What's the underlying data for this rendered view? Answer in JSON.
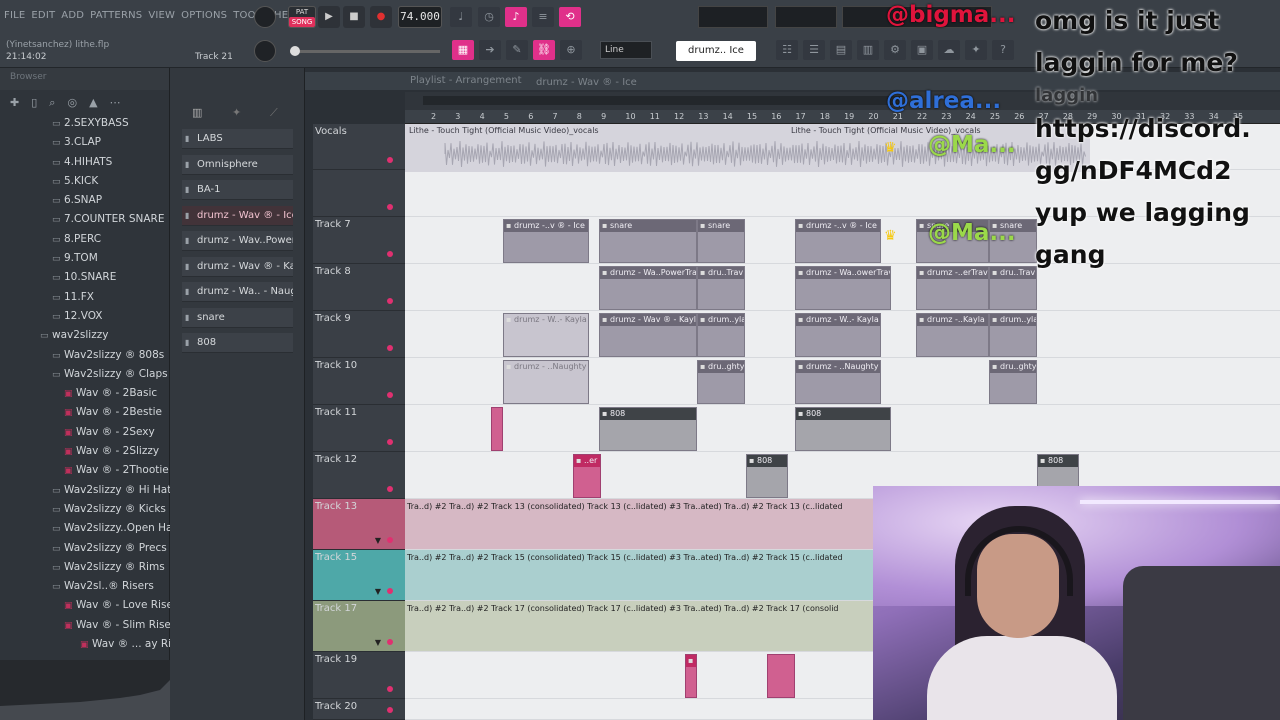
{
  "menu": [
    "FILE",
    "EDIT",
    "ADD",
    "PATTERNS",
    "VIEW",
    "OPTIONS",
    "TOOLS",
    "HELP"
  ],
  "topbar": {
    "hint": "(Yinetsanchez) lithe.flp",
    "clock": "21:14:02",
    "track_indicator": "Track 21",
    "pat_label": "PAT",
    "song_label": "SONG",
    "tempo": "74.000",
    "snap": "Line",
    "pattern": "drumz.. Ice"
  },
  "browser": {
    "title": "Browser",
    "items": [
      {
        "icon": "folder",
        "label": "2.SEXYBASS",
        "indent": 52
      },
      {
        "icon": "folder",
        "label": "3.CLAP",
        "indent": 52
      },
      {
        "icon": "folder",
        "label": "4.HIHATS",
        "indent": 52
      },
      {
        "icon": "folder",
        "label": "5.KICK",
        "indent": 52
      },
      {
        "icon": "folder",
        "label": "6.SNAP",
        "indent": 52
      },
      {
        "icon": "folder",
        "label": "7.COUNTER SNARE",
        "indent": 52
      },
      {
        "icon": "folder",
        "label": "8.PERC",
        "indent": 52
      },
      {
        "icon": "folder",
        "label": "9.TOM",
        "indent": 52
      },
      {
        "icon": "folder",
        "label": "10.SNARE",
        "indent": 52
      },
      {
        "icon": "folder",
        "label": "11.FX",
        "indent": 52
      },
      {
        "icon": "folder",
        "label": "12.VOX",
        "indent": 52
      },
      {
        "icon": "folder",
        "label": "wav2slizzy",
        "indent": 40
      },
      {
        "icon": "folder",
        "label": "Wav2slizzy ® 808s",
        "indent": 52
      },
      {
        "icon": "folder",
        "label": "Wav2slizzy ® Claps",
        "indent": 52
      },
      {
        "icon": "pattern",
        "label": "Wav ® - 2Basic",
        "indent": 64
      },
      {
        "icon": "pattern",
        "label": "Wav ® - 2Bestie",
        "indent": 64
      },
      {
        "icon": "pattern",
        "label": "Wav ® - 2Sexy",
        "indent": 64
      },
      {
        "icon": "pattern",
        "label": "Wav ® - 2Slizzy",
        "indent": 64
      },
      {
        "icon": "pattern",
        "label": "Wav ® - 2Thootie",
        "indent": 64
      },
      {
        "icon": "folder",
        "label": "Wav2slizzy ® Hi Hats",
        "indent": 52
      },
      {
        "icon": "folder",
        "label": "Wav2slizzy ® Kicks",
        "indent": 52
      },
      {
        "icon": "folder",
        "label": "Wav2slizzy..Open Hats",
        "indent": 52
      },
      {
        "icon": "folder",
        "label": "Wav2slizzy ® Precs",
        "indent": 52
      },
      {
        "icon": "folder",
        "label": "Wav2slizzy ® Rims",
        "indent": 52
      },
      {
        "icon": "folder",
        "label": "Wav2sl..® Risers",
        "indent": 52
      },
      {
        "icon": "pattern",
        "label": "Wav ® - Love Riser",
        "indent": 64
      },
      {
        "icon": "pattern",
        "label": "Wav ® - Slim Riser",
        "indent": 64
      },
      {
        "icon": "pattern",
        "label": "Wav ® ... ay Riser",
        "indent": 80
      }
    ]
  },
  "channels": [
    "LABS",
    "Omnisphere",
    "BA-1",
    "drumz - Wav ® - Ice",
    "drumz - Wav..PowerTrav",
    "drumz - Wav ® - Kayla",
    "drumz - Wa.. - Naughty",
    "snare",
    "808"
  ],
  "playlist": {
    "title": "Playlist - Arrangement",
    "pattern": "drumz - Wav ® - Ice",
    "ruler": [
      "2",
      "3",
      "4",
      "5",
      "6",
      "7",
      "8",
      "9",
      "10",
      "11",
      "12",
      "13",
      "14",
      "15",
      "16",
      "17",
      "18",
      "19",
      "20",
      "21",
      "22",
      "23",
      "24",
      "25",
      "26",
      "27",
      "28",
      "29",
      "30",
      "31",
      "32",
      "33",
      "34",
      "35"
    ],
    "tracks": [
      "Vocals",
      "",
      "Track 7",
      "Track 8",
      "Track 9",
      "Track 10",
      "Track 11",
      "Track 12",
      "Track 13",
      "Track 15",
      "Track 17",
      "Track 19",
      "Track 20"
    ],
    "vocal_clips": [
      "Lithe - Touch Tight (Official Music Video)_vocals",
      "Lithe - Touch Tight (Official Music Video)_vocals"
    ],
    "clips": {
      "t7": [
        "drumz -..v ® - Ice",
        "snare",
        "snare",
        "drumz -..v ® - Ice",
        "snare",
        "snare"
      ],
      "t8": [
        "drumz - Wa..PowerTrav",
        "dru..Trav",
        "drumz - Wa..owerTrav",
        "drumz -..erTrav",
        "dru..Trav"
      ],
      "t9": [
        "drumz - W..- Kayla",
        "drumz - Wav ® - Kayla",
        "drum..yla",
        "drumz - W..- Kayla",
        "drumz -..Kayla",
        "drum..yla"
      ],
      "t10": [
        "drumz - ..Naughty",
        "dru..ghty",
        "drumz - ..Naughty",
        "dru..ghty"
      ],
      "t11": [
        "808",
        "808"
      ],
      "t12": [
        "..er",
        "808",
        "808"
      ],
      "t19": [
        "..er"
      ],
      "t13": "Tra..d) #2  Tra..d) #2  Track 13 (consolidated)  Track 13 (c..lidated) #3  Tra..ated)  Tra..d) #2  Track 13 (c..lidated",
      "t15": "Tra..d) #2  Tra..d) #2  Track 15 (consolidated)  Track 15 (c..lidated) #3  Tra..ated)  Tra..d) #2  Track 15 (c..lidated",
      "t17": "Tra..d) #2  Tra..d) #2  Track 17 (consolidated)  Track 17 (c..lidated) #3  Tra..ated)  Tra..d) #2  Track 17 (consolid"
    }
  },
  "overlay": {
    "handles": [
      "@bigma...",
      "@alrea...",
      "@Ma...",
      "@Ma..."
    ],
    "chat": [
      "omg is it just",
      "laggin for me?",
      "laggin",
      "https://discord.",
      "gg/nDF4MCd2",
      "yup we lagging",
      "gang"
    ],
    "colors": {
      "red": "#e0143c",
      "blue": "#2f6fd8",
      "green": "#9bd94a"
    }
  }
}
